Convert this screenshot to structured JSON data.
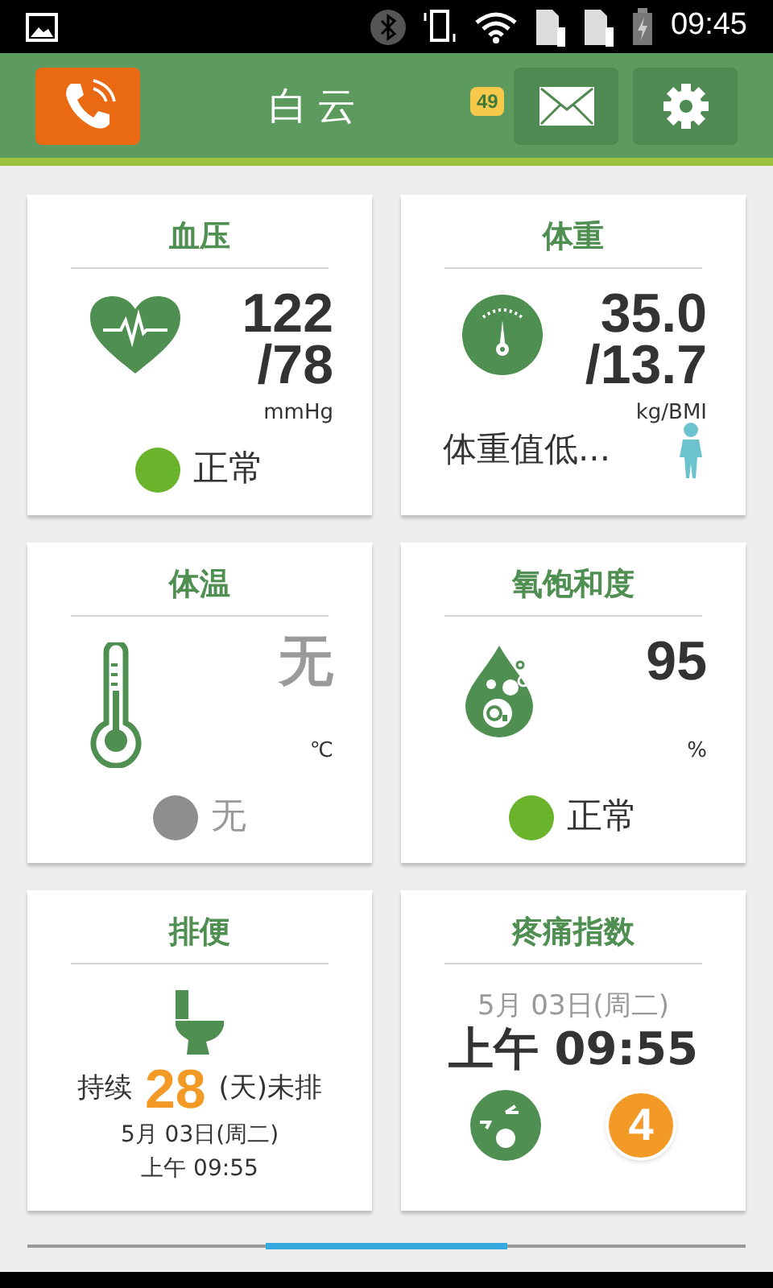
{
  "status_bar": {
    "time": "09:45"
  },
  "header": {
    "title": "白云",
    "message_count": "49"
  },
  "cards": [
    {
      "kind": "reading",
      "title": "血压",
      "lines": [
        "122",
        "/78"
      ],
      "unit": "mmHg",
      "status": {
        "label": "正常",
        "color": "#6ab42c"
      }
    },
    {
      "kind": "weight",
      "title": "体重",
      "lines": [
        "35.0",
        "/13.7"
      ],
      "unit": "kg/BMI",
      "note": "体重值低..."
    },
    {
      "kind": "reading",
      "title": "体温",
      "lines": [
        "无"
      ],
      "muted": true,
      "unit": "℃",
      "status": {
        "label": "无",
        "color": "#8e8e8e"
      }
    },
    {
      "kind": "reading",
      "title": "氧饱和度",
      "lines": [
        "95"
      ],
      "muted": false,
      "unit": "%",
      "status": {
        "label": "正常",
        "color": "#6ab42c"
      }
    },
    {
      "kind": "bowel",
      "title": "排便",
      "prefix": "持续",
      "days": "28",
      "suffix": "(天)未排",
      "date": "5月 03日(周二)",
      "time": "上午 09:55"
    },
    {
      "kind": "pain",
      "title": "疼痛指数",
      "date": "5月 03日(周二)",
      "time": "上午 09:55",
      "score": "4"
    }
  ]
}
